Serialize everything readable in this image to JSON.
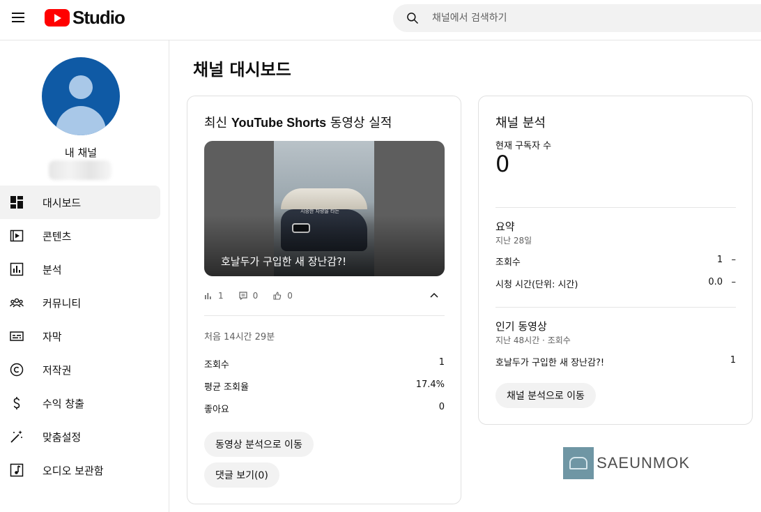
{
  "header": {
    "logo_text": "Studio",
    "search_placeholder": "채널에서 검색하기"
  },
  "sidebar": {
    "channel_label": "내 채널",
    "items": [
      {
        "label": "대시보드",
        "icon": "dashboard-icon",
        "active": true
      },
      {
        "label": "콘텐츠",
        "icon": "content-icon",
        "active": false
      },
      {
        "label": "분석",
        "icon": "analytics-icon",
        "active": false
      },
      {
        "label": "커뮤니티",
        "icon": "community-icon",
        "active": false
      },
      {
        "label": "자막",
        "icon": "subtitles-icon",
        "active": false
      },
      {
        "label": "저작권",
        "icon": "copyright-icon",
        "active": false
      },
      {
        "label": "수익 창출",
        "icon": "monetization-icon",
        "active": false
      },
      {
        "label": "맞춤설정",
        "icon": "customization-icon",
        "active": false
      },
      {
        "label": "오디오 보관함",
        "icon": "audio-library-icon",
        "active": false
      }
    ]
  },
  "main": {
    "page_title": "채널 대시보드"
  },
  "shorts_card": {
    "title_pre": "최신 ",
    "title_bold": "YouTube Shorts",
    "title_post": " 동영상 실적",
    "thumbnail_subtitle": "시승한 차량을 타는",
    "video_title": "호날두가 구입한 새 장난감?!",
    "views_count": "1",
    "comments_count": "0",
    "likes_count": "0",
    "first_period": "처음 14시간 29분",
    "rows": [
      {
        "label": "조회수",
        "value": "1"
      },
      {
        "label": "평균 조회율",
        "value": "17.4%"
      },
      {
        "label": "좋아요",
        "value": "0"
      }
    ],
    "analytics_button": "동영상 분석으로 이동",
    "comments_button": "댓글 보기(0)"
  },
  "analytics_card": {
    "title": "채널 분석",
    "subscribers_label": "현재 구독자 수",
    "subscribers_value": "0",
    "summary_title": "요약",
    "summary_period": "지난 28일",
    "summary_rows": [
      {
        "label": "조회수",
        "value": "1",
        "trend": "–"
      },
      {
        "label": "시청 시간(단위: 시간)",
        "value": "0.0",
        "trend": "–"
      }
    ],
    "top_videos_title": "인기 동영상",
    "top_videos_meta": "지난 48시간 · 조회수",
    "top_video_title": "호날두가 구입한 새 장난감?!",
    "top_video_views": "1",
    "button": "채널 분석으로 이동"
  },
  "watermark": {
    "text": "SAEUNMOK"
  },
  "colors": {
    "brand_red": "#ff0000",
    "avatar_blue": "#0f5aa5"
  }
}
